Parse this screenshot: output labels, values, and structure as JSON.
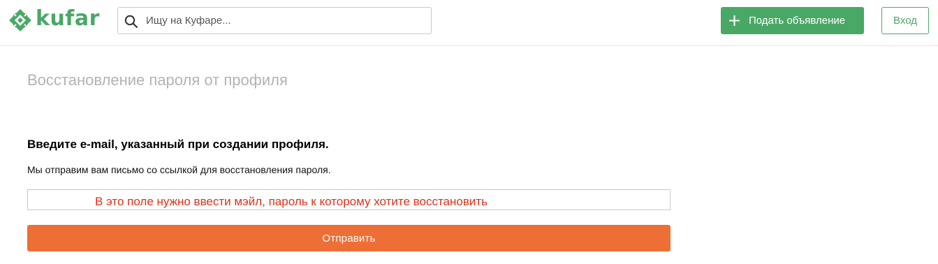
{
  "header": {
    "logo_text": "kufar",
    "search": {
      "placeholder": "Ищу на Куфаре...",
      "value": ""
    },
    "post_button_label": "Подать объявление",
    "login_button_label": "Вход"
  },
  "main": {
    "page_title": "Восстановление пароля от профиля",
    "instruction": "Введите e-mail, указанный при создании профиля.",
    "subtext": "Мы отправим вам письмо со ссылкой для восстановления пароля.",
    "email_field": {
      "value": ""
    },
    "annotation": "В это поле нужно ввести мэйл, пароль к которому хотите восстановить",
    "submit_button_label": "Отправить"
  },
  "icons": {
    "logo": "kufar-logo-icon",
    "search": "search-icon",
    "plus": "plus-icon"
  },
  "colors": {
    "brand_green": "#4aa867",
    "submit_orange": "#ee6f36",
    "annotation_red": "#e0311a",
    "title_gray": "#b3b3b3"
  }
}
